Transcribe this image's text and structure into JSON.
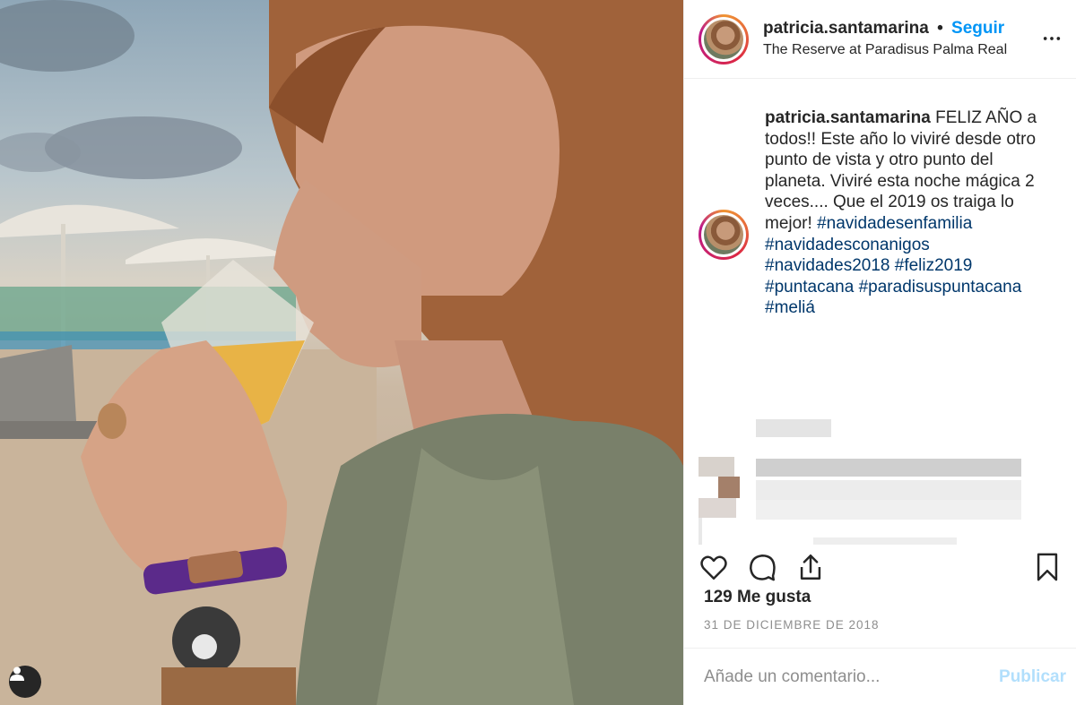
{
  "post": {
    "username": "patricia.santamarina",
    "follow_label": "Seguir",
    "separator": "•",
    "location": "The Reserve at Paradisus Palma Real",
    "caption_text": "FELIZ AÑO a todos!! Este año lo viviré desde otro punto de vista y otro punto del planeta. Viviré esta noche mágica 2 veces.... Que el 2019 os traiga lo mejor!",
    "hashtags": [
      "#navidadesenfamilia",
      "#navidadesconanigos",
      "#navidades2018",
      "#feliz2019",
      "#puntacana",
      "#paradisuspuntacana",
      "#meliá"
    ],
    "likes": "129 Me gusta",
    "date": "31 DE DICIEMBRE DE 2018"
  },
  "comment_box": {
    "placeholder": "Añade un comentario...",
    "publish_label": "Publicar"
  },
  "icons": {
    "more": "more-options-icon",
    "like": "heart-icon",
    "comment": "comment-icon",
    "share": "share-icon",
    "save": "bookmark-icon",
    "user_tag": "user-tag-icon"
  },
  "colors": {
    "link": "#0095f6",
    "hashtag": "#00376b",
    "publish_disabled": "#b2dffc",
    "muted": "#8e8e8e"
  }
}
